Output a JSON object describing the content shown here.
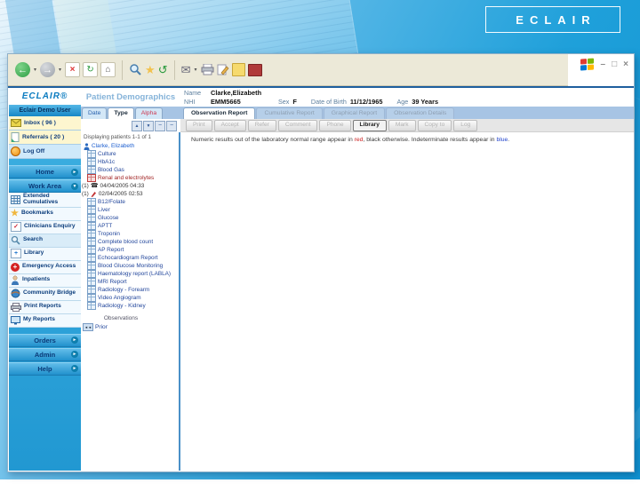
{
  "slide": {
    "logo": "ECLAIR"
  },
  "window": {
    "controls": {
      "minimize": "–",
      "restore": "□",
      "close": "×"
    },
    "toolbar": {
      "icons": [
        "back",
        "back-dropdown",
        "forward",
        "forward-dropdown",
        "stop",
        "refresh",
        "home",
        "search",
        "favorites",
        "history",
        "mail",
        "mail-dropdown",
        "print",
        "edit",
        "discuss",
        "messenger"
      ]
    },
    "sidebar": {
      "logo": "ECLAIR®",
      "user": "Eclair Demo User",
      "quick_links": [
        {
          "label": "Inbox ( 96 )",
          "icon": "inbox-icon"
        },
        {
          "label": "Referrals ( 20 )",
          "icon": "referrals-icon"
        },
        {
          "label": "Log Off",
          "icon": "log-off-icon"
        }
      ],
      "sections": {
        "home": "Home",
        "work_area": "Work Area",
        "orders": "Orders",
        "admin": "Admin",
        "help": "Help"
      },
      "work_items": [
        {
          "label": "Extended Cumulatives",
          "icon": "table-icon"
        },
        {
          "label": "Bookmarks",
          "icon": "star-icon"
        },
        {
          "label": "Clinicians Enquiry",
          "icon": "checklist-icon"
        },
        {
          "label": "Search",
          "icon": "magnifier-icon"
        },
        {
          "label": "Library",
          "icon": "library-icon"
        },
        {
          "label": "Emergency Access",
          "icon": "emergency-icon"
        },
        {
          "label": "Inpatients",
          "icon": "patient-icon"
        },
        {
          "label": "Community Bridge",
          "icon": "globe-icon"
        },
        {
          "label": "Print Reports",
          "icon": "printer-icon"
        },
        {
          "label": "My Reports",
          "icon": "monitor-icon"
        }
      ]
    },
    "demographics": {
      "title": "Patient Demographics",
      "name_label": "Name",
      "name": "Clarke,Elizabeth",
      "nhi_label": "NHI",
      "nhi": "EMM5665",
      "sex_label": "Sex",
      "sex": "F",
      "dob_label": "Date of Birth",
      "dob": "11/12/1965",
      "age_label": "Age",
      "age": "39 Years"
    },
    "tree": {
      "tabs": {
        "date": "Date",
        "type": "Type",
        "alpha": "Alpha"
      },
      "controls": {
        "sort_up": "▲",
        "sort_down": "▼",
        "collapse": "−",
        "collapse_all": "−"
      },
      "status": "Displaying patients 1-1 of 1",
      "items": [
        {
          "icon": "patient",
          "label": "Clarke, Elizabeth"
        },
        {
          "icon": "grid",
          "label": "Culture"
        },
        {
          "icon": "grid",
          "label": "HbA1c"
        },
        {
          "icon": "grid",
          "label": "Blood Gas"
        },
        {
          "icon": "grid-red",
          "label": "Renal and electrolytes"
        },
        {
          "icon": "phone",
          "prefix": "(1)",
          "label": "04/04/2005 04:33"
        },
        {
          "icon": "pencil",
          "prefix": "(1)",
          "label": "02/04/2005 02:53"
        },
        {
          "icon": "grid",
          "label": "B12/Folate"
        },
        {
          "icon": "grid",
          "label": "Liver"
        },
        {
          "icon": "grid",
          "label": "Glucose"
        },
        {
          "icon": "grid",
          "label": "APTT"
        },
        {
          "icon": "grid",
          "label": "Troponin"
        },
        {
          "icon": "grid",
          "label": "Complete blood count"
        },
        {
          "icon": "grid",
          "label": "AP Report"
        },
        {
          "icon": "grid",
          "label": "Echocardiogram Report"
        },
        {
          "icon": "grid",
          "label": "Blood Glucose Monitoring"
        },
        {
          "icon": "grid",
          "label": "Haematology report (LABLA)"
        },
        {
          "icon": "grid",
          "label": "MRI Report"
        },
        {
          "icon": "grid",
          "label": "Radiology - Forearm"
        },
        {
          "icon": "grid",
          "label": "Video Angiogram"
        },
        {
          "icon": "grid",
          "label": "Radiology - Kidney"
        }
      ],
      "observations_label": "Observations",
      "prior_label": "Prior"
    },
    "report": {
      "tabs": [
        "Observation Report",
        "Cumulative Report",
        "Graphical Report",
        "Observation Details"
      ],
      "active_tab": "Observation Report",
      "buttons": [
        "Print",
        "Accept",
        "Refer",
        "Comment",
        "Phone",
        "Library",
        "Mark",
        "Copy to",
        "Log"
      ],
      "active_button": "Library",
      "legend": {
        "part1": "Numeric results out of the laboratory normal range appear in ",
        "red_word": "red",
        "part2": ", black otherwise. Indeterminate results appear in ",
        "blue_word": "blue",
        "part3": "."
      }
    }
  }
}
